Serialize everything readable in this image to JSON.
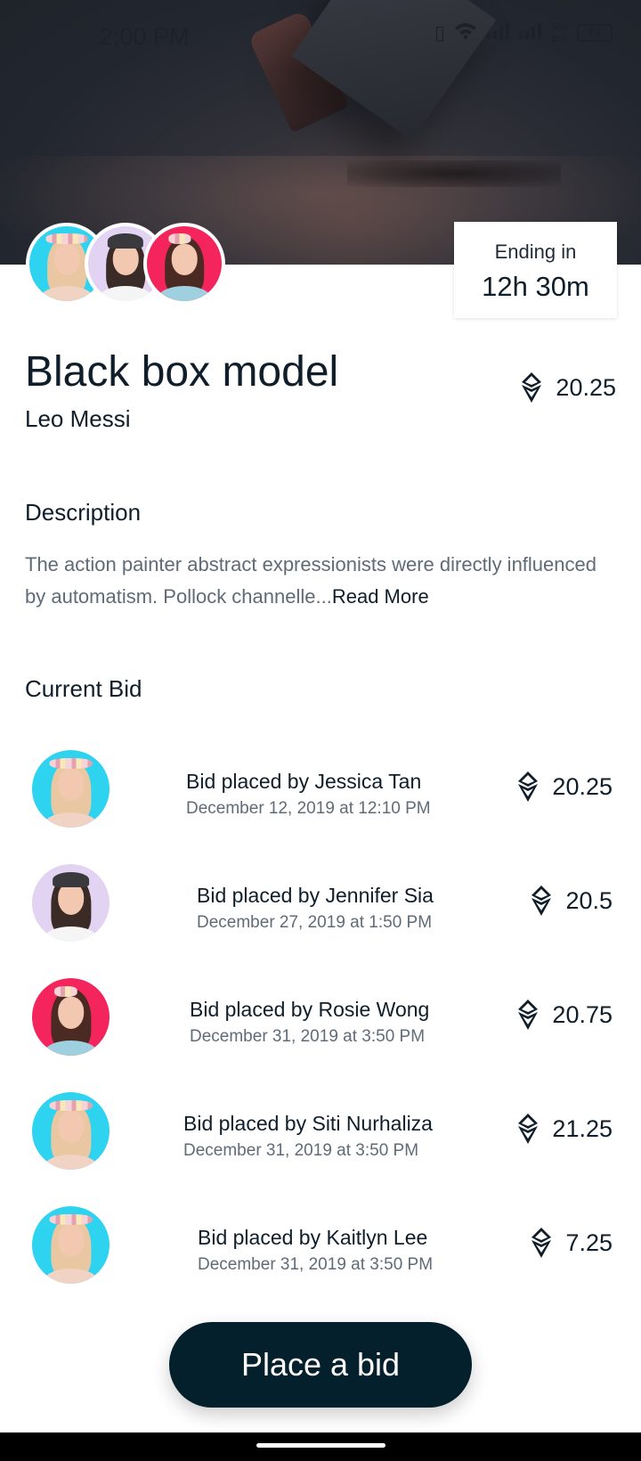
{
  "status_bar": {
    "time": "2:00 PM",
    "net_speed_value": "360",
    "net_speed_unit": "B/s",
    "battery": "76"
  },
  "ending": {
    "label": "Ending in",
    "value": "12h 30m"
  },
  "item": {
    "title": "Black box model",
    "author": "Leo Messi",
    "price": "20.25",
    "currency_icon": "ethereum-icon"
  },
  "description": {
    "heading": "Description",
    "text": "The action painter abstract expressionists were directly influenced by automatism. Pollock channelle...",
    "read_more": "Read More"
  },
  "current_bid": {
    "heading": "Current Bid",
    "bids": [
      {
        "label": "Bid placed by Jessica Tan",
        "date": "December 12, 2019 at 12:10 PM",
        "amount": "20.25"
      },
      {
        "label": "Bid placed by Jennifer Sia",
        "date": "December 27, 2019 at 1:50 PM",
        "amount": "20.5"
      },
      {
        "label": "Bid placed by Rosie Wong",
        "date": "December 31, 2019 at 3:50 PM",
        "amount": "20.75"
      },
      {
        "label": "Bid placed by Siti Nurhaliza",
        "date": "December 31, 2019 at 3:50 PM",
        "amount": "21.25"
      },
      {
        "label": "Bid placed by Kaitlyn Lee",
        "date": "December 31, 2019 at 3:50 PM",
        "amount": "7.25"
      }
    ]
  },
  "actions": {
    "place_bid": "Place a bid"
  },
  "colors": {
    "primary_dark": "#04202c",
    "avatar_cyan": "#2ed3f0",
    "avatar_lavender": "#e3d3f2",
    "avatar_pink": "#f4255c"
  }
}
